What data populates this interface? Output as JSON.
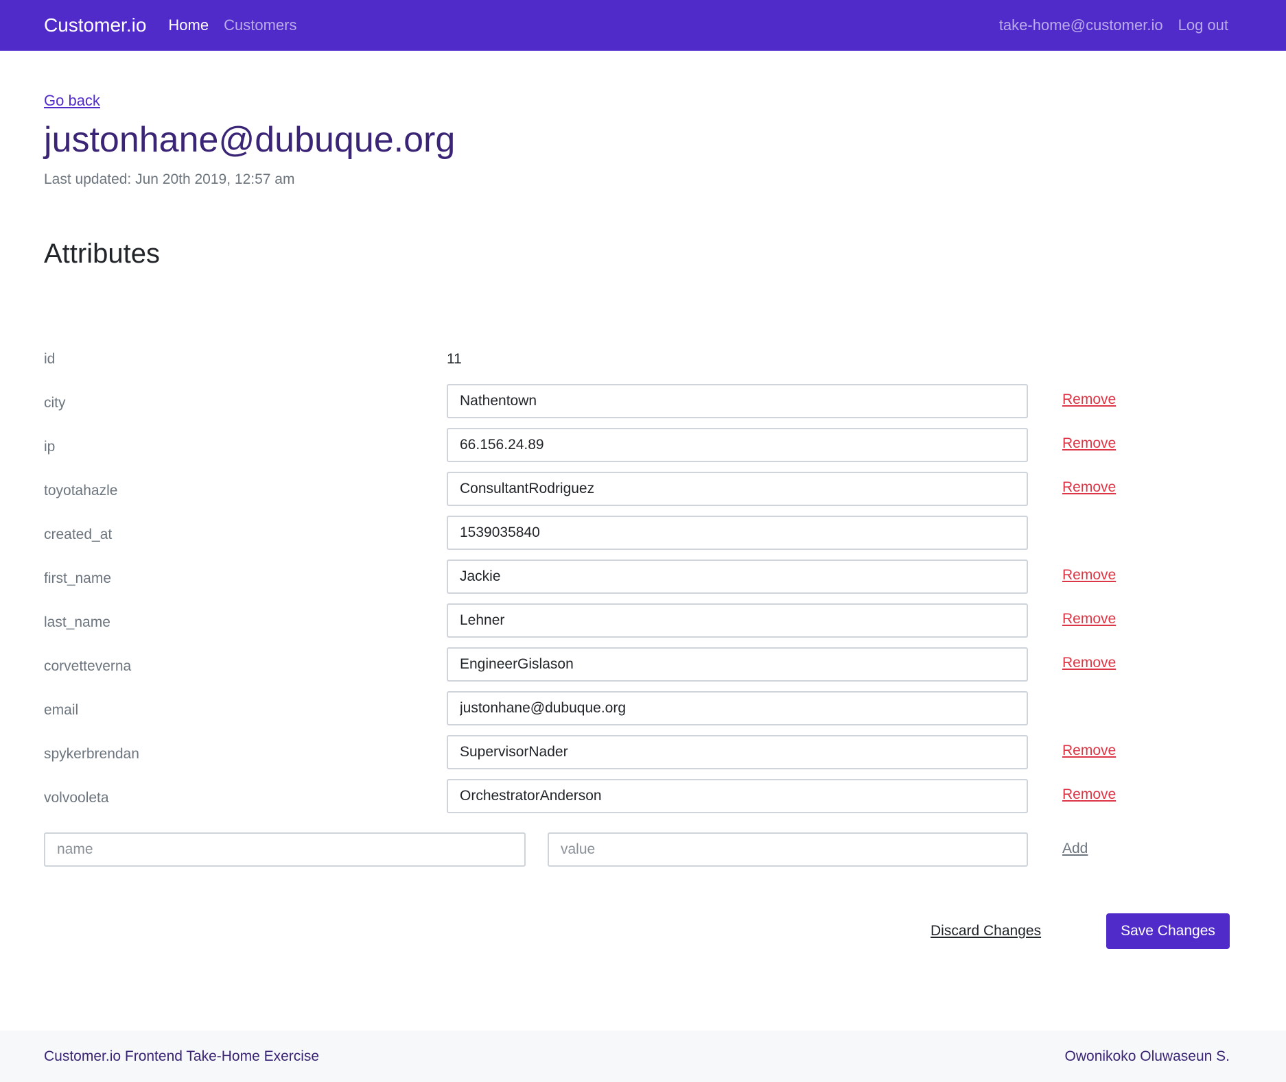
{
  "navbar": {
    "brand": "Customer.io",
    "links": [
      {
        "label": "Home",
        "active": true
      },
      {
        "label": "Customers",
        "active": false
      }
    ],
    "user_email": "take-home@customer.io",
    "logout_label": "Log out"
  },
  "page": {
    "back_label": "Go back",
    "title": "justonhane@dubuque.org",
    "last_updated": "Last updated: Jun 20th 2019, 12:57 am",
    "section_title": "Attributes"
  },
  "attributes": [
    {
      "name": "id",
      "value": "11",
      "editable": false,
      "removable": false
    },
    {
      "name": "city",
      "value": "Nathentown",
      "editable": true,
      "removable": true
    },
    {
      "name": "ip",
      "value": "66.156.24.89",
      "editable": true,
      "removable": true
    },
    {
      "name": "toyotahazle",
      "value": "ConsultantRodriguez",
      "editable": true,
      "removable": true
    },
    {
      "name": "created_at",
      "value": "1539035840",
      "editable": true,
      "removable": false
    },
    {
      "name": "first_name",
      "value": "Jackie",
      "editable": true,
      "removable": true
    },
    {
      "name": "last_name",
      "value": "Lehner",
      "editable": true,
      "removable": true
    },
    {
      "name": "corvetteverna",
      "value": "EngineerGislason",
      "editable": true,
      "removable": true
    },
    {
      "name": "email",
      "value": "justonhane@dubuque.org",
      "editable": true,
      "removable": false
    },
    {
      "name": "spykerbrendan",
      "value": "SupervisorNader",
      "editable": true,
      "removable": true
    },
    {
      "name": "volvooleta",
      "value": "OrchestratorAnderson",
      "editable": true,
      "removable": true
    }
  ],
  "remove_label": "Remove",
  "new_attribute": {
    "name_placeholder": "name",
    "value_placeholder": "value",
    "add_label": "Add"
  },
  "actions": {
    "discard_label": "Discard Changes",
    "save_label": "Save Changes"
  },
  "footer": {
    "left": "Customer.io Frontend Take-Home Exercise",
    "right": "Owonikoko Oluwaseun S."
  },
  "colors": {
    "brand": "#512bc9",
    "title": "#3a2475",
    "danger": "#dc3545"
  }
}
